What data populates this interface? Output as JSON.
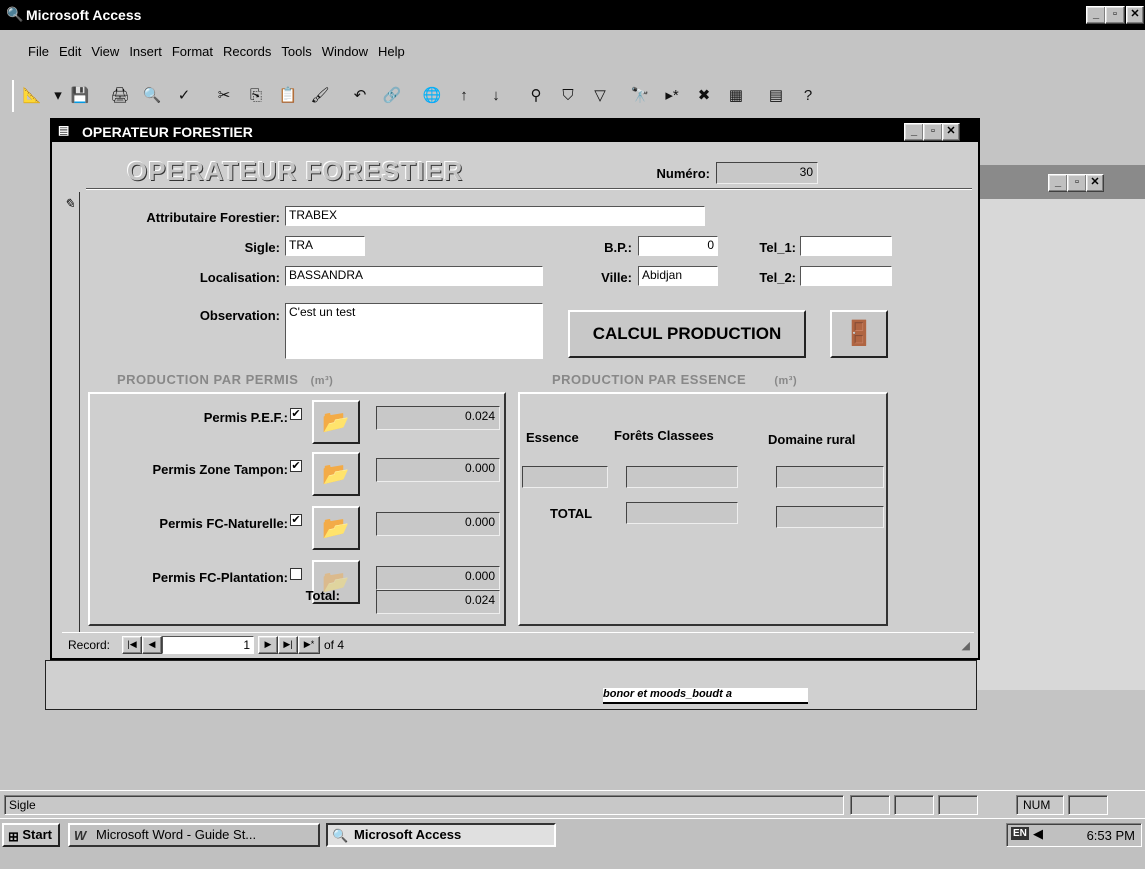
{
  "app": {
    "title": "Microsoft Access"
  },
  "menu": [
    "File",
    "Edit",
    "View",
    "Insert",
    "Format",
    "Records",
    "Tools",
    "Window",
    "Help"
  ],
  "toolbar_icons": [
    "design-view-icon",
    "dropdown-icon",
    "save-icon",
    "print-icon",
    "print-preview-icon",
    "spelling-icon",
    "cut-icon",
    "copy-icon",
    "paste-icon",
    "format-painter-icon",
    "undo-icon",
    "insert-hyperlink-icon",
    "web-toolbar-icon",
    "sort-ascending-icon",
    "sort-descending-icon",
    "filter-by-selection-icon",
    "filter-by-form-icon",
    "apply-filter-icon",
    "find-icon",
    "new-record-icon",
    "delete-record-icon",
    "database-window-icon",
    "new-object-icon",
    "help-icon"
  ],
  "form": {
    "window_title": "OPERATEUR FORESTIER",
    "header_title": "OPERATEUR FORESTIER",
    "numero_label": "Numéro:",
    "numero_value": "30",
    "fields": {
      "attributaire_label": "Attributaire Forestier:",
      "attributaire_value": "TRABEX",
      "sigle_label": "Sigle:",
      "sigle_value": "TRA",
      "localisation_label": "Localisation:",
      "localisation_value": "BASSANDRA",
      "observation_label": "Observation:",
      "observation_value": "C'est un test",
      "bp_label": "B.P.:",
      "bp_value": "0",
      "ville_label": "Ville:",
      "ville_value": "Abidjan",
      "tel1_label": "Tel_1:",
      "tel1_value": "",
      "tel2_label": "Tel_2:",
      "tel2_value": ""
    },
    "calcul_button": "CALCUL PRODUCTION",
    "production_permis": {
      "heading": "PRODUCTION PAR PERMIS",
      "unit": "(m³)",
      "rows": [
        {
          "label": "Permis P.E.F.:",
          "checked": true,
          "value": "0.024"
        },
        {
          "label": "Permis Zone Tampon:",
          "checked": true,
          "value": "0.000"
        },
        {
          "label": "Permis FC-Naturelle:",
          "checked": true,
          "value": "0.000"
        },
        {
          "label": "Permis FC-Plantation:",
          "checked": false,
          "value": "0.000"
        }
      ],
      "total_label": "Total:",
      "total_value": "0.024"
    },
    "production_essence": {
      "heading": "PRODUCTION PAR ESSENCE",
      "unit": "(m³)",
      "col_essence": "Essence",
      "col_forets": "Forêts Classees",
      "col_domaine": "Domaine rural",
      "total_label": "TOTAL"
    },
    "navigator": {
      "label": "Record:",
      "current": "1",
      "of_text": "of 4"
    }
  },
  "behind_text": "bonor et moods_boudt a",
  "status": {
    "left": "Sigle",
    "num": "NUM"
  },
  "taskbar": {
    "start": "Start",
    "items": [
      "Microsoft Word - Guide St...",
      "Microsoft Access"
    ],
    "lang": "EN",
    "time": "6:53 PM"
  }
}
